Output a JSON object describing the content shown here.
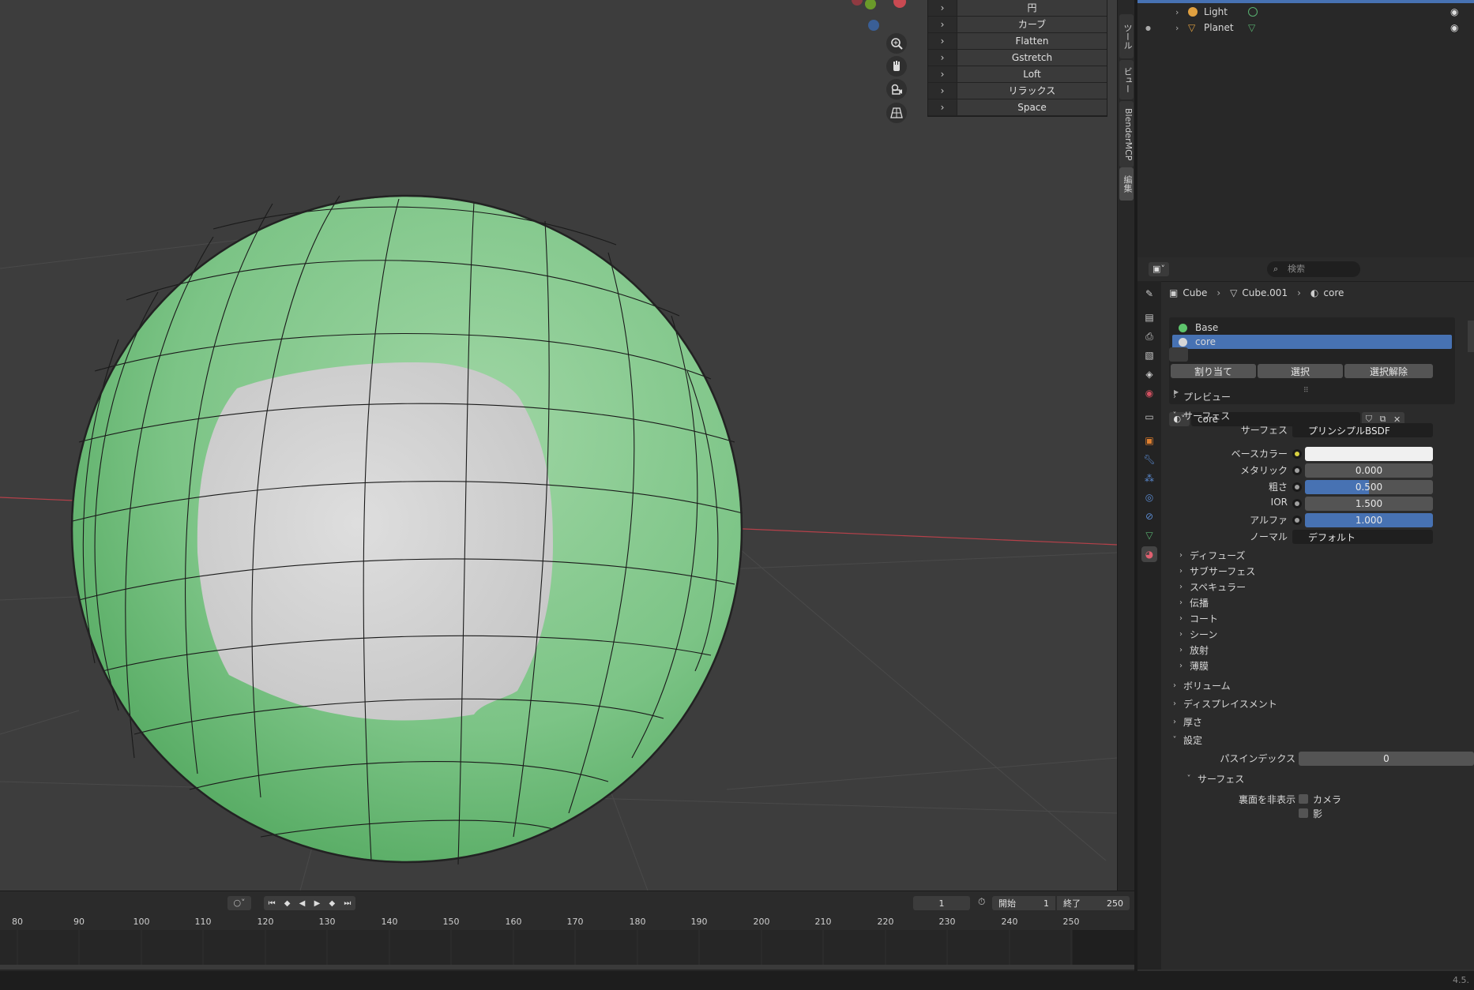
{
  "colors": {
    "accent_blue": "#4772b3",
    "sphere_green": "#7cc486",
    "core_white": "#d6d6d6",
    "x_axis": "#b5414a",
    "y_axis": "#6a9a2a"
  },
  "specials_menu": {
    "items": [
      "円",
      "カーブ",
      "Flatten",
      "Gstretch",
      "Loft",
      "リラックス",
      "Space"
    ]
  },
  "viewport_tools": [
    "zoom-icon",
    "hand-pan-icon",
    "camera-icon",
    "grid-perspective-icon"
  ],
  "n_panel_tabs": [
    "ツール",
    "ビュー",
    "BlenderMCP",
    "編集"
  ],
  "outliner": {
    "rows": [
      {
        "name": "Light",
        "icon": "light-icon"
      },
      {
        "name": "Planet",
        "icon": "mesh-icon"
      }
    ]
  },
  "properties": {
    "search_placeholder": "検索",
    "breadcrumb": [
      "Cube",
      "Cube.001",
      "core"
    ],
    "material_slots": [
      {
        "name": "Base",
        "color": "#5ec46c",
        "selected": false
      },
      {
        "name": "core",
        "color": "#d6d6d6",
        "selected": true
      }
    ],
    "material_name": "core",
    "buttons": {
      "assign": "割り当て",
      "select": "選択",
      "deselect": "選択解除"
    },
    "sections": {
      "preview": "プレビュー",
      "surface": "サーフェス",
      "volume": "ボリューム",
      "displacement": "ディスプレイスメント",
      "thickness": "厚さ",
      "settings": "設定"
    },
    "surface_fields": {
      "surface_label": "サーフェス",
      "surface_value": "プリンシプルBSDF",
      "base_color_label": "ベースカラー",
      "base_color_value": "#f0f0f0",
      "metallic_label": "メタリック",
      "metallic_value": "0.000",
      "roughness_label": "粗さ",
      "roughness_value": "0.500",
      "ior_label": "IOR",
      "ior_value": "1.500",
      "alpha_label": "アルファ",
      "alpha_value": "1.000",
      "normal_label": "ノーマル",
      "normal_value": "デフォルト"
    },
    "subsections": [
      "ディフューズ",
      "サブサーフェス",
      "スペキュラー",
      "伝播",
      "コート",
      "シーン",
      "放射",
      "薄膜"
    ],
    "settings_fields": {
      "pass_index_label": "パスインデックス",
      "pass_index_value": "0",
      "surface_sub": "サーフェス",
      "backface_label": "裏面を非表示",
      "camera_label": "カメラ",
      "shadow_label": "影"
    }
  },
  "timeline": {
    "current_frame": "1",
    "start_label": "開始",
    "start_value": "1",
    "end_label": "終了",
    "end_value": "250",
    "ticks": [
      "80",
      "90",
      "100",
      "110",
      "120",
      "130",
      "140",
      "150",
      "160",
      "170",
      "180",
      "190",
      "200",
      "210",
      "220",
      "230",
      "240",
      "250"
    ]
  },
  "status": {
    "version": "4.5."
  }
}
